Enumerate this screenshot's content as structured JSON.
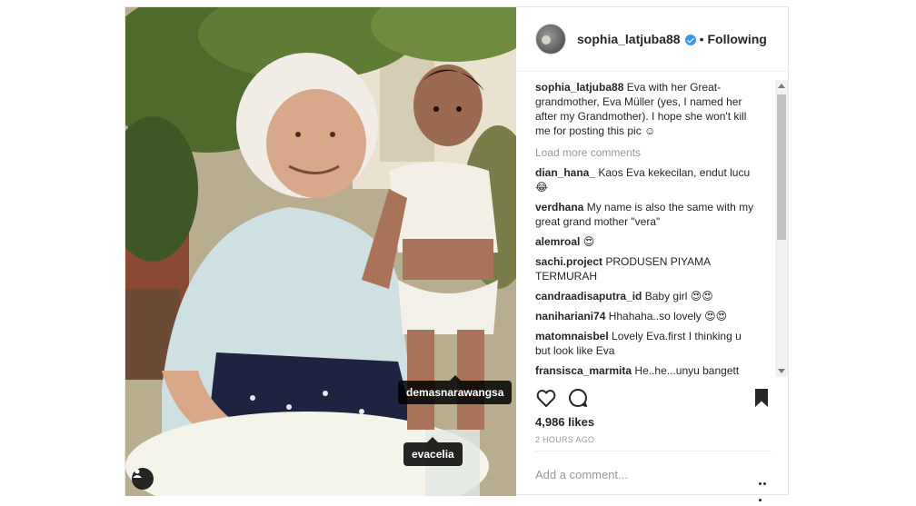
{
  "post": {
    "username": "sophia_latjuba88",
    "follow_separator": "•",
    "follow_status": "Following",
    "caption": {
      "user": "sophia_latjuba88",
      "text": "Eva with her Great-grandmother, Eva Müller (yes, I named her after my Grandmother). I hope she won't kill me for posting this pic ☺"
    },
    "load_more": "Load more comments",
    "comments": [
      {
        "user": "dian_hana_",
        "text": "Kaos Eva kekecilan, endut lucu 😂"
      },
      {
        "user": "verdhana",
        "text": "My name is also the same with my great grand mother \"vera\""
      },
      {
        "user": "alemroal",
        "text": "😍"
      },
      {
        "user": "sachi.project",
        "text": "PRODUSEN PIYAMA TERMURAH"
      },
      {
        "user": "candraadisaputra_id",
        "text": "Baby girl 😍😍"
      },
      {
        "user": "nanihariani74",
        "text": "Hhahaha..so lovely 😍😍"
      },
      {
        "user": "matomnaisbel",
        "text": "Lovely Eva.first I thinking u but look like Eva"
      },
      {
        "user": "fransisca_marmita",
        "text": "He..he...unyu bangett"
      }
    ],
    "likes": "4,986 likes",
    "time": "2 HOURS AGO",
    "add_comment_placeholder": "Add a comment...",
    "tags": [
      "demasnarawangsa",
      "evacelia"
    ]
  },
  "colors": {
    "verified": "#3897f0",
    "muted": "#999999",
    "text": "#262626"
  },
  "icons": [
    "verified-badge-icon",
    "heart-icon",
    "comment-icon",
    "bookmark-icon",
    "more-options-icon",
    "tagged-user-icon"
  ]
}
